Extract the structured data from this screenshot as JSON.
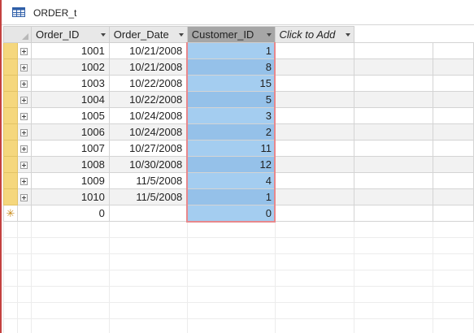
{
  "tab": {
    "title": "ORDER_t",
    "icon": "table-icon"
  },
  "columns": [
    {
      "label": "Order_ID",
      "selected": false,
      "italic": false
    },
    {
      "label": "Order_Date",
      "selected": false,
      "italic": false
    },
    {
      "label": "Customer_ID",
      "selected": true,
      "italic": false
    },
    {
      "label": "Click to Add",
      "selected": false,
      "italic": true
    }
  ],
  "rows": [
    {
      "order_id": "1001",
      "order_date": "10/21/2008",
      "customer_id": "1"
    },
    {
      "order_id": "1002",
      "order_date": "10/21/2008",
      "customer_id": "8"
    },
    {
      "order_id": "1003",
      "order_date": "10/22/2008",
      "customer_id": "15"
    },
    {
      "order_id": "1004",
      "order_date": "10/22/2008",
      "customer_id": "5"
    },
    {
      "order_id": "1005",
      "order_date": "10/24/2008",
      "customer_id": "3"
    },
    {
      "order_id": "1006",
      "order_date": "10/24/2008",
      "customer_id": "2"
    },
    {
      "order_id": "1007",
      "order_date": "10/27/2008",
      "customer_id": "11"
    },
    {
      "order_id": "1008",
      "order_date": "10/30/2008",
      "customer_id": "12"
    },
    {
      "order_id": "1009",
      "order_date": "11/5/2008",
      "customer_id": "4"
    },
    {
      "order_id": "1010",
      "order_date": "11/5/2008",
      "customer_id": "1"
    }
  ],
  "new_row": {
    "marker": "✳",
    "order_id": "0",
    "order_date": "",
    "customer_id": "0"
  },
  "colors": {
    "record_selector": "#f5d77d",
    "selected_column": "#a4cdf0",
    "selected_column_border": "#e8888c",
    "frame_accent": "#c4413f"
  }
}
